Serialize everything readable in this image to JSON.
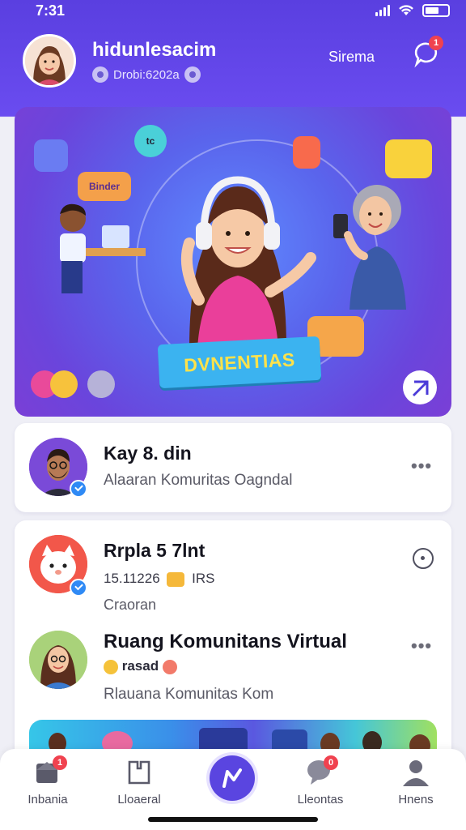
{
  "status_bar": {
    "time": "7:31"
  },
  "header": {
    "username": "hidunlesacim",
    "subline": "Drobi:6202a",
    "action_label": "Sirema",
    "chat_badge": "1"
  },
  "banner": {
    "ribbon_text": "DVNENTIAS",
    "tag_left": "Binder",
    "tag_top": "tc"
  },
  "cards": [
    {
      "title": "Kay 8. din",
      "subtitle": "Alaaran Komuritas Oagndal",
      "action_icon": "more-icon"
    }
  ],
  "list": [
    {
      "title": "Rrpla 5 7lnt",
      "meta": "15.11226",
      "meta_suffix": "IRS",
      "sub": "Craoran",
      "action_icon": "location-pin-icon"
    },
    {
      "title": "Ruang Komunitans Virtual",
      "meta": "rasad",
      "sub": "Rlauana Komunitas Kom",
      "action_icon": "more-icon"
    }
  ],
  "more_glyph": "•••",
  "bottom_nav": {
    "items": [
      {
        "label": "Inbania",
        "icon": "inbox-icon",
        "badge": "1"
      },
      {
        "label": "Lloaeral",
        "icon": "discover-icon"
      },
      {
        "label": "",
        "icon": "compose-icon"
      },
      {
        "label": "Lleontas",
        "icon": "chat-icon",
        "badge": "0"
      },
      {
        "label": "Hnens",
        "icon": "profile-icon"
      }
    ]
  },
  "colors": {
    "brand": "#5a45e0",
    "badge": "#f0424f",
    "verified": "#2f8af5"
  }
}
